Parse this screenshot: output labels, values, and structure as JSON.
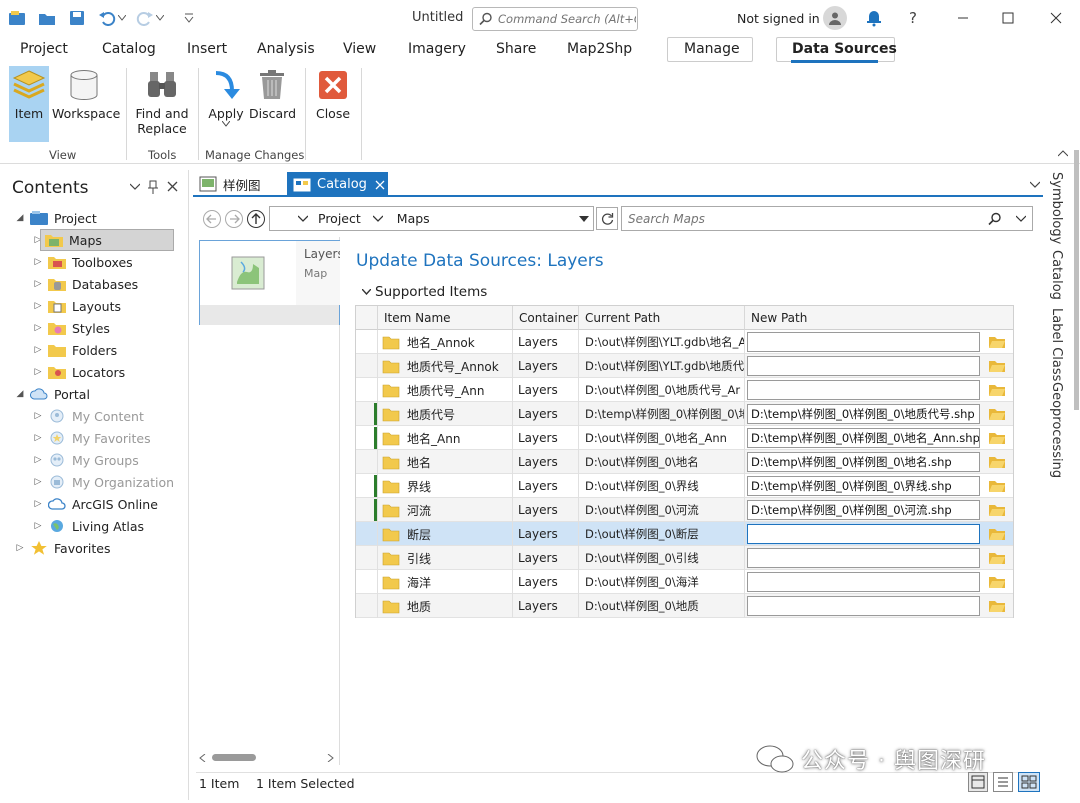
{
  "app": {
    "title": "Untitled",
    "command_search_placeholder": "Command Search (Alt+Q)",
    "signin": "Not signed in",
    "help": "?"
  },
  "ribbon_tabs": [
    "Project",
    "Catalog",
    "Insert",
    "Analysis",
    "View",
    "Imagery",
    "Share",
    "Map2Shp",
    "Manage",
    "Data Sources"
  ],
  "ribbon": {
    "item": "Item",
    "workspace": "Workspace",
    "find_replace_1": "Find and",
    "find_replace_2": "Replace",
    "apply": "Apply",
    "discard": "Discard",
    "close": "Close",
    "groups": {
      "view": "View",
      "tools": "Tools",
      "manage": "Manage Changes"
    }
  },
  "contents": {
    "title": "Contents",
    "items": [
      {
        "label": "Project"
      },
      {
        "label": "Maps"
      },
      {
        "label": "Toolboxes"
      },
      {
        "label": "Databases"
      },
      {
        "label": "Layouts"
      },
      {
        "label": "Styles"
      },
      {
        "label": "Folders"
      },
      {
        "label": "Locators"
      },
      {
        "label": "Portal"
      },
      {
        "label": "My Content"
      },
      {
        "label": "My Favorites"
      },
      {
        "label": "My Groups"
      },
      {
        "label": "My Organization"
      },
      {
        "label": "ArcGIS Online"
      },
      {
        "label": "Living Atlas"
      },
      {
        "label": "Favorites"
      }
    ]
  },
  "doc_tabs": {
    "map": "样例图",
    "catalog": "Catalog"
  },
  "catalog": {
    "address": {
      "project": "Project",
      "maps": "Maps"
    },
    "search_placeholder": "Search Maps",
    "item_card": {
      "name": "Layers",
      "type": "Map"
    },
    "status": {
      "count": "1 Item",
      "selected": "1 Item Selected"
    },
    "update_title": "Update Data Sources: Layers",
    "supported": "Supported Items",
    "columns": {
      "name": "Item Name",
      "container": "Container",
      "current": "Current Path",
      "new": "New Path"
    },
    "rows": [
      {
        "name": "地名_Annok",
        "container": "Layers",
        "current": "D:\\out\\样例图\\YLT.gdb\\地名_A",
        "new": ""
      },
      {
        "name": "地质代号_Annok",
        "container": "Layers",
        "current": "D:\\out\\样例图\\YLT.gdb\\地质代",
        "new": ""
      },
      {
        "name": "地质代号_Ann",
        "container": "Layers",
        "current": "D:\\out\\样例图_0\\地质代号_Ar",
        "new": ""
      },
      {
        "name": "地质代号",
        "container": "Layers",
        "current": "D:\\temp\\样例图_0\\样例图_0\\地",
        "new": "D:\\temp\\样例图_0\\样例图_0\\地质代号.shp"
      },
      {
        "name": "地名_Ann",
        "container": "Layers",
        "current": "D:\\out\\样例图_0\\地名_Ann",
        "new": "D:\\temp\\样例图_0\\样例图_0\\地名_Ann.shp"
      },
      {
        "name": "地名",
        "container": "Layers",
        "current": "D:\\out\\样例图_0\\地名",
        "new": "D:\\temp\\样例图_0\\样例图_0\\地名.shp"
      },
      {
        "name": "界线",
        "container": "Layers",
        "current": "D:\\out\\样例图_0\\界线",
        "new": "D:\\temp\\样例图_0\\样例图_0\\界线.shp"
      },
      {
        "name": "河流",
        "container": "Layers",
        "current": "D:\\out\\样例图_0\\河流",
        "new": "D:\\temp\\样例图_0\\样例图_0\\河流.shp"
      },
      {
        "name": "断层",
        "container": "Layers",
        "current": "D:\\out\\样例图_0\\断层",
        "new": ""
      },
      {
        "name": "引线",
        "container": "Layers",
        "current": "D:\\out\\样例图_0\\引线",
        "new": ""
      },
      {
        "name": "海洋",
        "container": "Layers",
        "current": "D:\\out\\样例图_0\\海洋",
        "new": ""
      },
      {
        "name": "地质",
        "container": "Layers",
        "current": "D:\\out\\样例图_0\\地质",
        "new": ""
      }
    ]
  },
  "side_tabs": [
    "Symbology",
    "Catalog",
    "Label Class",
    "Geoprocessing"
  ],
  "watermark": "公众号 · 舆图深研",
  "colors": {
    "accent": "#1e73be",
    "folder": "#f2c94c",
    "selected_row": "#cfe3f6",
    "ribbon_active": "#a9d3f2"
  }
}
